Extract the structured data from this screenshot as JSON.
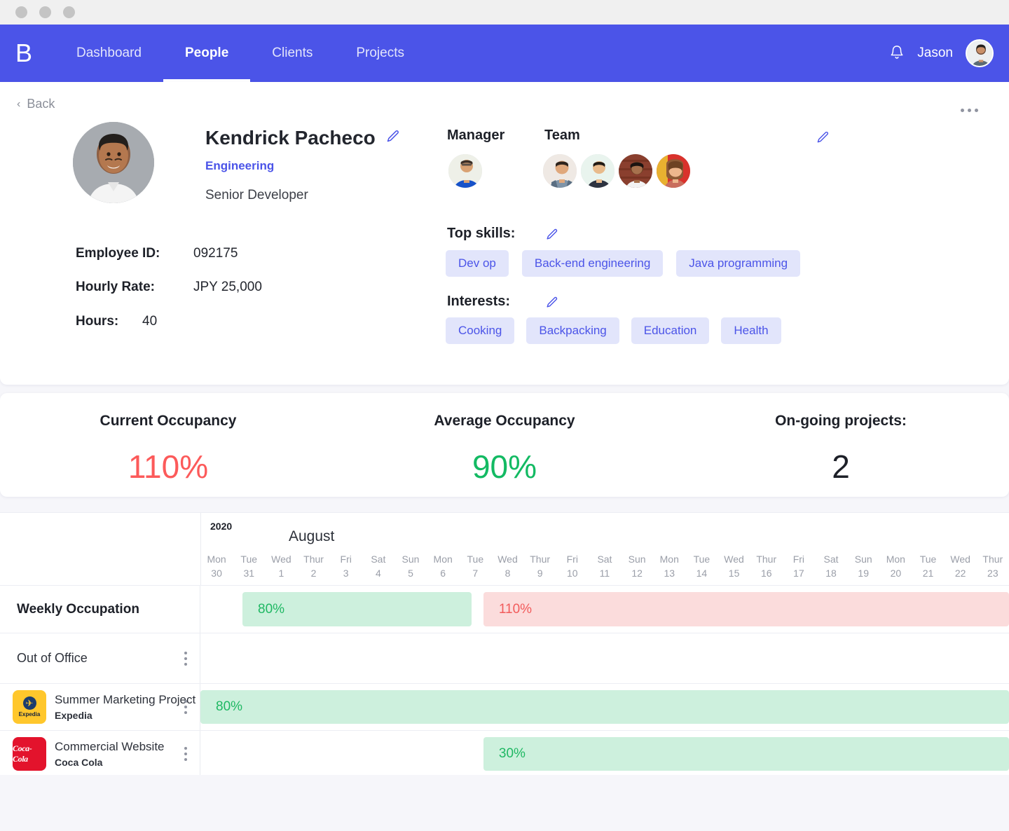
{
  "window": {
    "dots": 3
  },
  "nav": {
    "brand": "B",
    "links": [
      {
        "label": "Dashboard",
        "active": false
      },
      {
        "label": "People",
        "active": true
      },
      {
        "label": "Clients",
        "active": false
      },
      {
        "label": "Projects",
        "active": false
      }
    ],
    "bell_icon": "bell-icon",
    "username": "Jason",
    "accent": "#4b54e8"
  },
  "profile": {
    "back_label": "Back",
    "name": "Kendrick Pacheco",
    "department": "Engineering",
    "role": "Senior Developer",
    "fields": [
      {
        "key": "Employee ID:",
        "value": "092175"
      },
      {
        "key": "Hourly Rate:",
        "value": "JPY 25,000"
      },
      {
        "key": "Hours:",
        "value": "40"
      }
    ],
    "manager_label": "Manager",
    "team_label": "Team",
    "team_count": 4,
    "skills_label": "Top skills:",
    "skills": [
      "Dev op",
      "Back-end engineering",
      "Java programming"
    ],
    "interests_label": "Interests:",
    "interests": [
      "Cooking",
      "Backpacking",
      "Education",
      "Health"
    ],
    "chip_bg": "#e2e5fb",
    "chip_color": "#4b54e8"
  },
  "stats": [
    {
      "label": "Current Occupancy",
      "value": "110%",
      "color": "#fc5a5a"
    },
    {
      "label": "Average Occupancy",
      "value": "90%",
      "color": "#13ba63"
    },
    {
      "label": "On-going projects:",
      "value": "2",
      "color": "#1d2028"
    }
  ],
  "timeline": {
    "year": "2020",
    "month": "August",
    "days": [
      {
        "dow": "Mon",
        "dn": "30"
      },
      {
        "dow": "Tue",
        "dn": "31"
      },
      {
        "dow": "Wed",
        "dn": "1"
      },
      {
        "dow": "Thur",
        "dn": "2"
      },
      {
        "dow": "Fri",
        "dn": "3"
      },
      {
        "dow": "Sat",
        "dn": "4"
      },
      {
        "dow": "Sun",
        "dn": "5"
      },
      {
        "dow": "Mon",
        "dn": "6"
      },
      {
        "dow": "Tue",
        "dn": "7"
      },
      {
        "dow": "Wed",
        "dn": "8"
      },
      {
        "dow": "Thur",
        "dn": "9"
      },
      {
        "dow": "Fri",
        "dn": "10"
      },
      {
        "dow": "Sat",
        "dn": "11"
      },
      {
        "dow": "Sun",
        "dn": "12"
      },
      {
        "dow": "Mon",
        "dn": "13"
      },
      {
        "dow": "Tue",
        "dn": "14"
      },
      {
        "dow": "Wed",
        "dn": "15"
      },
      {
        "dow": "Thur",
        "dn": "16"
      },
      {
        "dow": "Fri",
        "dn": "17"
      },
      {
        "dow": "Sat",
        "dn": "18"
      },
      {
        "dow": "Sun",
        "dn": "19"
      },
      {
        "dow": "Mon",
        "dn": "20"
      },
      {
        "dow": "Tue",
        "dn": "21"
      },
      {
        "dow": "Wed",
        "dn": "22"
      },
      {
        "dow": "Thur",
        "dn": "23"
      }
    ],
    "rows": {
      "weekly": {
        "label": "Weekly Occupation",
        "bars": [
          {
            "value": "80%",
            "type": "green",
            "start_pct": 5.2,
            "width_pct": 28.3
          },
          {
            "value": "110%",
            "type": "red",
            "start_pct": 35.0,
            "width_pct": 65.0
          }
        ]
      },
      "out_of_office": {
        "label": "Out of Office",
        "bars": []
      },
      "projects": [
        {
          "logo": "expedia-logo",
          "logo_text": "Expedia",
          "name": "Summer Marketing Project",
          "client": "Expedia",
          "bars": [
            {
              "value": "80%",
              "type": "green",
              "start_pct": 0,
              "width_pct": 100
            }
          ]
        },
        {
          "logo": "coca-cola-logo",
          "logo_text": "Coca-Cola",
          "name": "Commercial Website",
          "client": "Coca Cola",
          "bars": [
            {
              "value": "30%",
              "type": "green",
              "start_pct": 35.0,
              "width_pct": 65.0
            }
          ]
        }
      ]
    }
  }
}
